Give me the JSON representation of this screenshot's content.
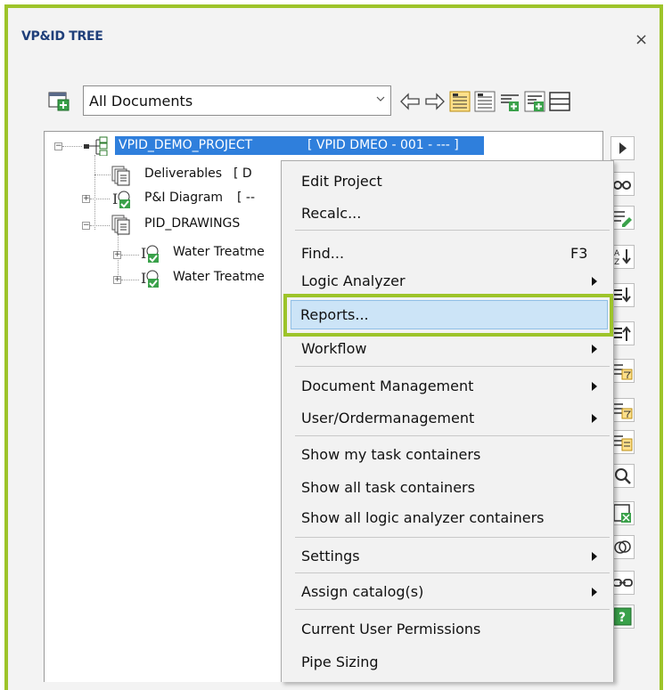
{
  "window": {
    "title": "VP&ID TREE",
    "close_label": "×"
  },
  "toolbar": {
    "document_filter": "All Documents"
  },
  "tree": {
    "root": {
      "label": "VPID_DEMO_PROJECT",
      "code": "[ VPID DMEO - 001 - --- ]"
    },
    "nodes": [
      {
        "label": "Deliverables",
        "suffix": "[ D"
      },
      {
        "label": "P&I Diagram",
        "suffix": "[ --"
      },
      {
        "label": "PID_DRAWINGS",
        "suffix": ""
      },
      {
        "label": "Water Treatme",
        "suffix": ""
      },
      {
        "label": "Water Treatme",
        "suffix": ""
      }
    ]
  },
  "context_menu": {
    "items": [
      {
        "label": "Edit Project"
      },
      {
        "label": "Recalc..."
      },
      {
        "label": "Find...",
        "shortcut": "F3"
      },
      {
        "label": "Logic Analyzer",
        "submenu": true
      },
      {
        "label": "Reports...",
        "highlighted": true
      },
      {
        "label": "Workflow",
        "submenu": true
      },
      {
        "label": "Document Management",
        "submenu": true
      },
      {
        "label": "User/Ordermanagement",
        "submenu": true
      },
      {
        "label": "Show my task containers"
      },
      {
        "label": "Show all task containers"
      },
      {
        "label": "Show all logic analyzer containers"
      },
      {
        "label": "Settings",
        "submenu": true
      },
      {
        "label": "Assign catalog(s)",
        "submenu": true
      },
      {
        "label": "Current User Permissions"
      },
      {
        "label": "Pipe Sizing"
      }
    ]
  },
  "colors": {
    "accent": "#9dc42a",
    "selection": "#2f7fdc",
    "menu_highlight": "#cce4f7"
  }
}
